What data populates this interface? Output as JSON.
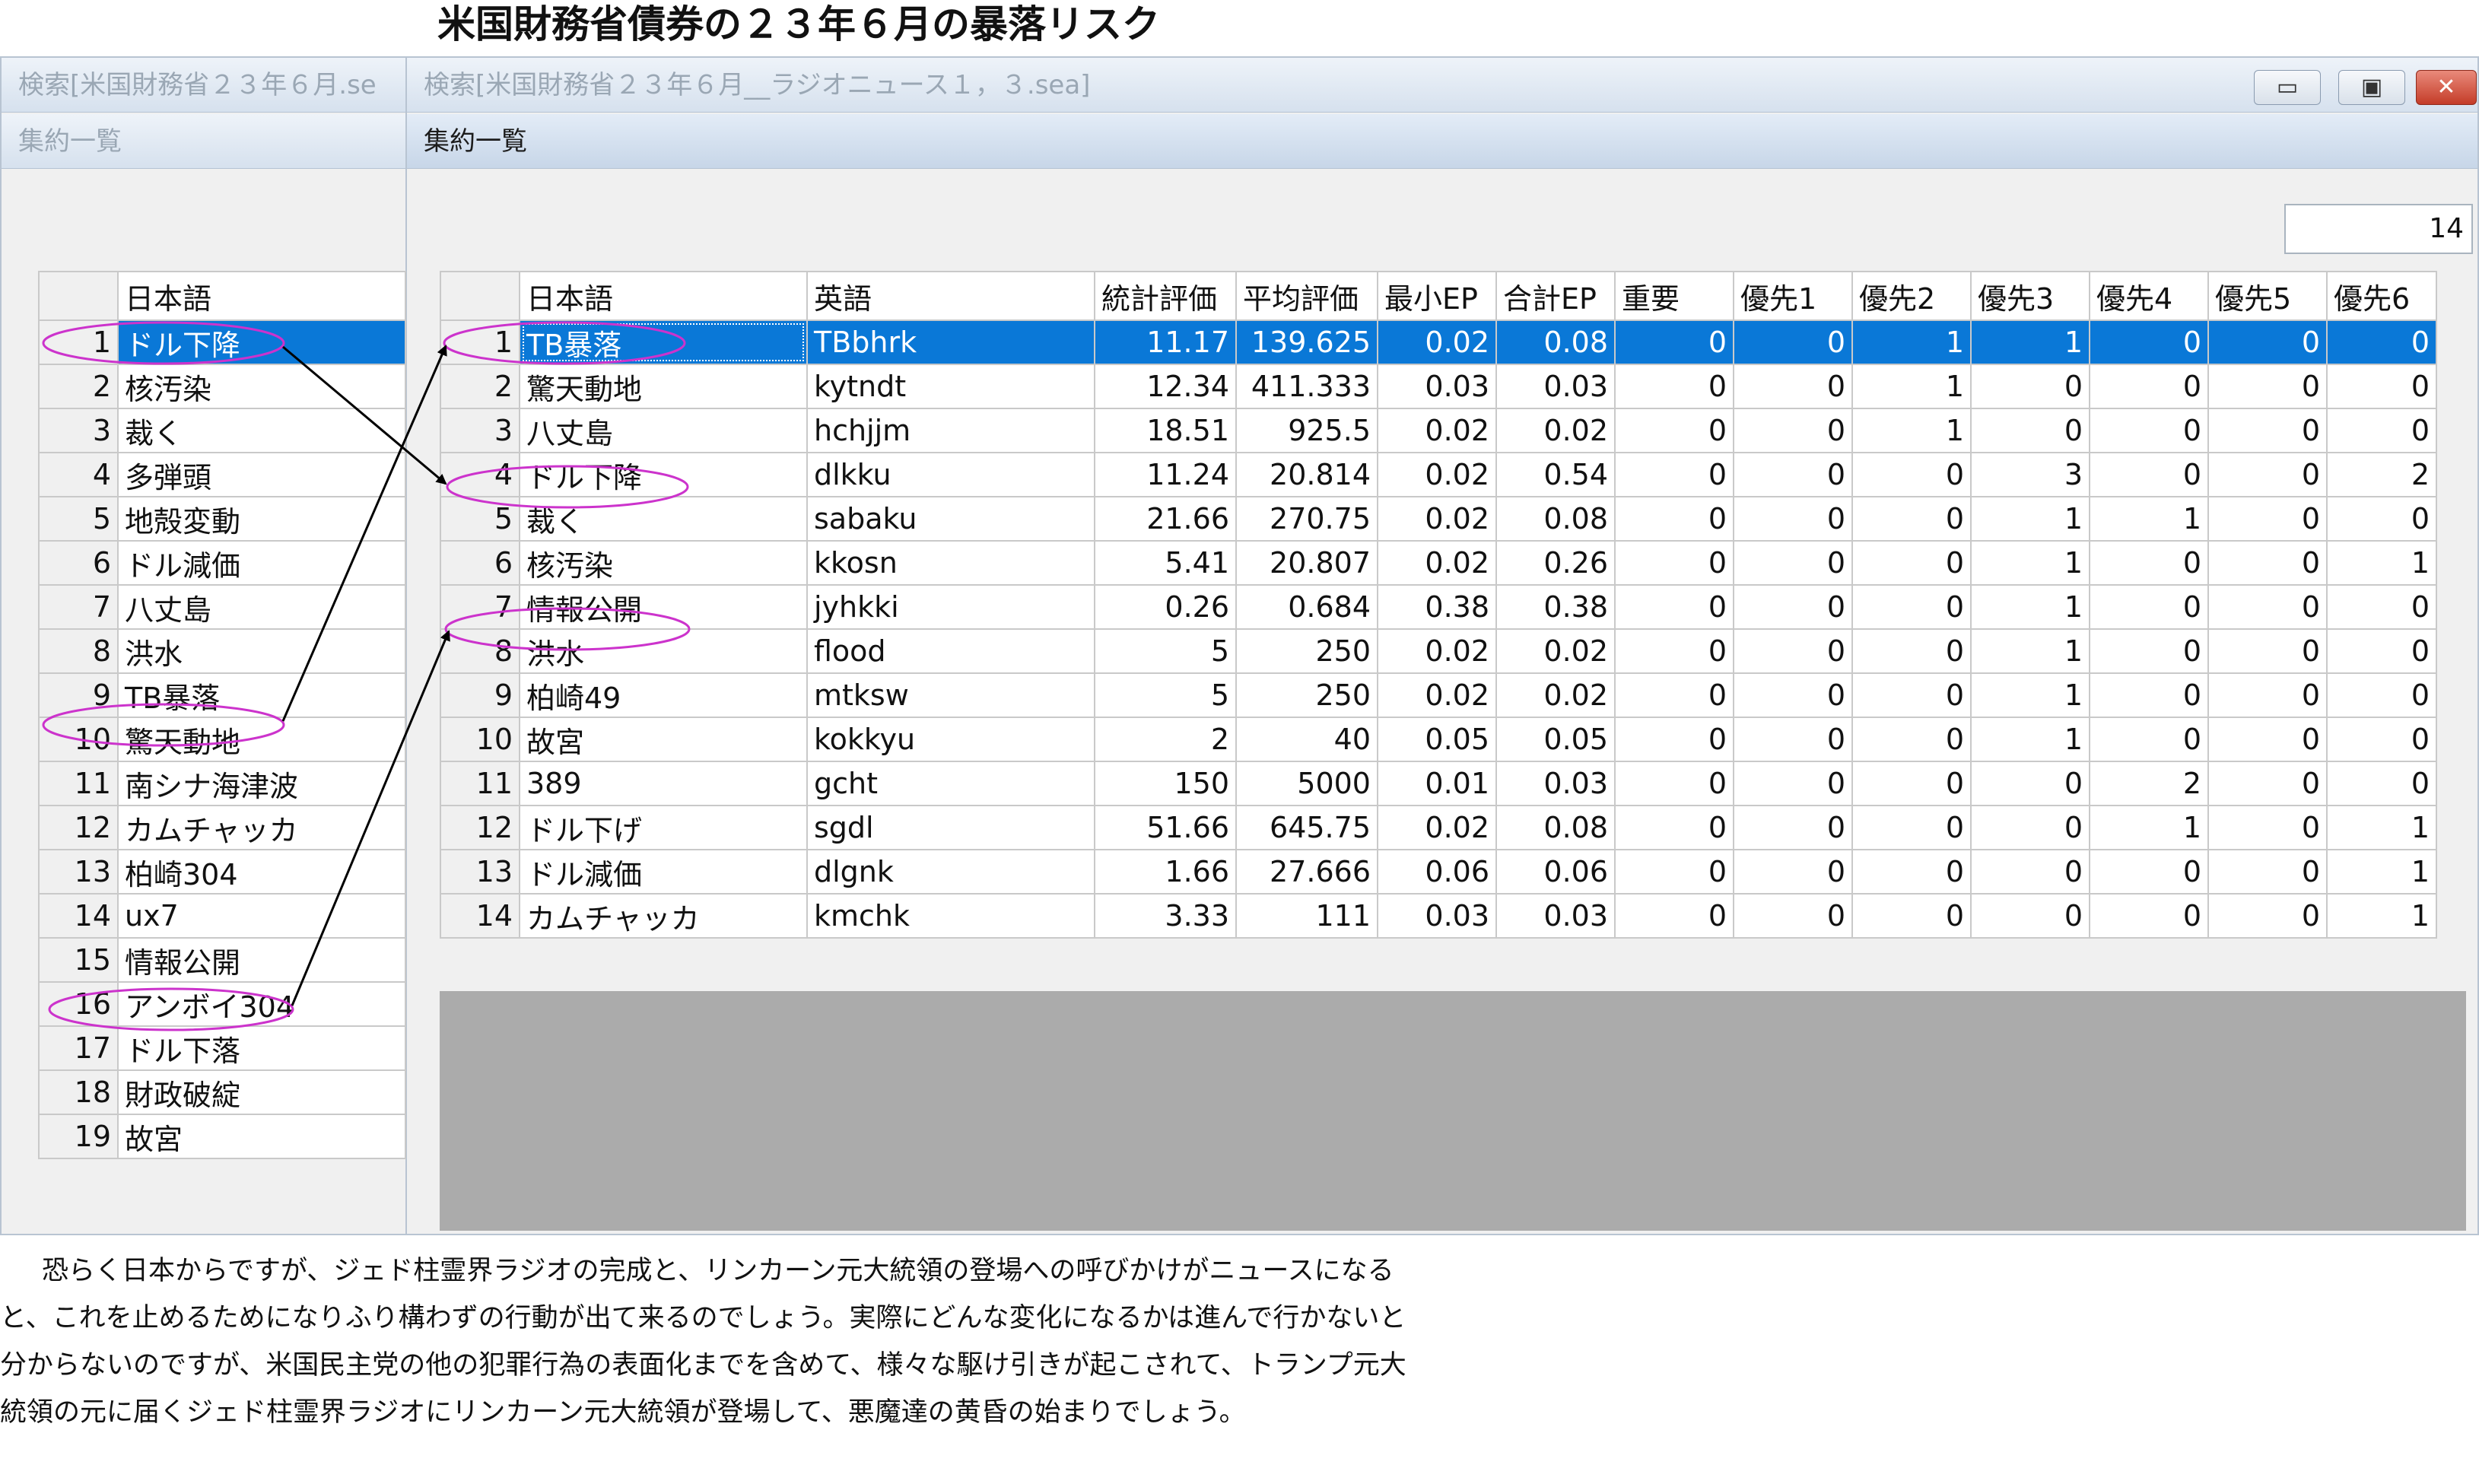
{
  "page_title": "米国財務省債券の２３年６月の暴落リスク",
  "windows": {
    "left": {
      "search_title": "検索[米国財務省２３年６月.se",
      "list_title": "集約一覧"
    },
    "right": {
      "search_title": "検索[米国財務省２３年６月__ラジオニュース１，３.sea]",
      "list_title": "集約一覧",
      "count": "14"
    }
  },
  "icons": {
    "minimize": "minimize-icon",
    "maximize": "maximize-icon",
    "close": "close-icon"
  },
  "left_grid": {
    "header": "日本語",
    "selected_row": 1,
    "rows": [
      {
        "n": "1",
        "ja": "ドル下降"
      },
      {
        "n": "2",
        "ja": "核汚染"
      },
      {
        "n": "3",
        "ja": "裁く"
      },
      {
        "n": "4",
        "ja": "多弾頭"
      },
      {
        "n": "5",
        "ja": "地殻変動"
      },
      {
        "n": "6",
        "ja": "ドル減価"
      },
      {
        "n": "7",
        "ja": "八丈島"
      },
      {
        "n": "8",
        "ja": "洪水"
      },
      {
        "n": "9",
        "ja": "TB暴落"
      },
      {
        "n": "10",
        "ja": "驚天動地"
      },
      {
        "n": "11",
        "ja": "南シナ海津波"
      },
      {
        "n": "12",
        "ja": "カムチャッカ"
      },
      {
        "n": "13",
        "ja": "柏崎304"
      },
      {
        "n": "14",
        "ja": "ux7"
      },
      {
        "n": "15",
        "ja": "情報公開"
      },
      {
        "n": "16",
        "ja": "アンボイ304"
      },
      {
        "n": "17",
        "ja": "ドル下落"
      },
      {
        "n": "18",
        "ja": "財政破綻"
      },
      {
        "n": "19",
        "ja": "故宮"
      }
    ]
  },
  "right_grid": {
    "headers": [
      "日本語",
      "英語",
      "統計評価",
      "平均評価",
      "最小EP",
      "合計EP",
      "重要",
      "優先1",
      "優先2",
      "優先3",
      "優先4",
      "優先5",
      "優先6"
    ],
    "selected_row": 1,
    "rows": [
      [
        "1",
        "TB暴落",
        "TBbhrk",
        "11.17",
        "139.625",
        "0.02",
        "0.08",
        "0",
        "0",
        "1",
        "1",
        "0",
        "0",
        "0"
      ],
      [
        "2",
        "驚天動地",
        "kytndt",
        "12.34",
        "411.333",
        "0.03",
        "0.03",
        "0",
        "0",
        "1",
        "0",
        "0",
        "0",
        "0"
      ],
      [
        "3",
        "八丈島",
        "hchjjm",
        "18.51",
        "925.5",
        "0.02",
        "0.02",
        "0",
        "0",
        "1",
        "0",
        "0",
        "0",
        "0"
      ],
      [
        "4",
        "ドル下降",
        "dlkku",
        "11.24",
        "20.814",
        "0.02",
        "0.54",
        "0",
        "0",
        "0",
        "3",
        "0",
        "0",
        "2"
      ],
      [
        "5",
        "裁く",
        "sabaku",
        "21.66",
        "270.75",
        "0.02",
        "0.08",
        "0",
        "0",
        "0",
        "1",
        "1",
        "0",
        "0"
      ],
      [
        "6",
        "核汚染",
        "kkosn",
        "5.41",
        "20.807",
        "0.02",
        "0.26",
        "0",
        "0",
        "0",
        "1",
        "0",
        "0",
        "1"
      ],
      [
        "7",
        "情報公開",
        "jyhkki",
        "0.26",
        "0.684",
        "0.38",
        "0.38",
        "0",
        "0",
        "0",
        "1",
        "0",
        "0",
        "0"
      ],
      [
        "8",
        "洪水",
        "flood",
        "5",
        "250",
        "0.02",
        "0.02",
        "0",
        "0",
        "0",
        "1",
        "0",
        "0",
        "0"
      ],
      [
        "9",
        "柏崎49",
        "mtksw",
        "5",
        "250",
        "0.02",
        "0.02",
        "0",
        "0",
        "0",
        "1",
        "0",
        "0",
        "0"
      ],
      [
        "10",
        "故宮",
        "kokkyu",
        "2",
        "40",
        "0.05",
        "0.05",
        "0",
        "0",
        "0",
        "1",
        "0",
        "0",
        "0"
      ],
      [
        "11",
        "389",
        "gcht",
        "150",
        "5000",
        "0.01",
        "0.03",
        "0",
        "0",
        "0",
        "0",
        "2",
        "0",
        "0"
      ],
      [
        "12",
        "ドル下げ",
        "sgdl",
        "51.66",
        "645.75",
        "0.02",
        "0.08",
        "0",
        "0",
        "0",
        "0",
        "1",
        "0",
        "1"
      ],
      [
        "13",
        "ドル減価",
        "dlgnk",
        "1.66",
        "27.666",
        "0.06",
        "0.06",
        "0",
        "0",
        "0",
        "0",
        "0",
        "0",
        "1"
      ],
      [
        "14",
        "カムチャッカ",
        "kmchk",
        "3.33",
        "111",
        "0.03",
        "0.03",
        "0",
        "0",
        "0",
        "0",
        "0",
        "0",
        "1"
      ]
    ]
  },
  "body_text": "恐らく日本からですが、ジェド柱霊界ラジオの完成と、リンカーン元大統領の登場への呼びかけがニュースになると、これを止めるためになりふり構わずの行動が出て来るのでしょう。実際にどんな変化になるかは進んで行かないと分からないのですが、米国民主党の他の犯罪行為の表面化までを含めて、様々な駆け引きが起こされて、トランプ元大統領の元に届くジェド柱霊界ラジオにリンカーン元大統領が登場して、悪魔達の黄昏の始まりでしょう。",
  "annotation_colors": {
    "ellipse": "#cc33cc",
    "arrow": "#000000",
    "selection": "#0a78d7"
  }
}
